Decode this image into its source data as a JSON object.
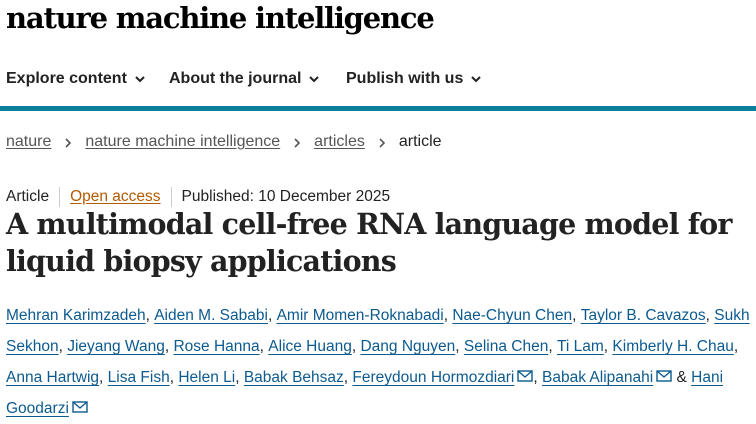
{
  "header": {
    "brand": "nature machine intelligence"
  },
  "nav": {
    "items": [
      {
        "label": "Explore content"
      },
      {
        "label": "About the journal"
      },
      {
        "label": "Publish with us"
      }
    ]
  },
  "breadcrumb": {
    "items": [
      {
        "label": "nature"
      },
      {
        "label": "nature machine intelligence"
      },
      {
        "label": "articles"
      },
      {
        "label": "article"
      }
    ]
  },
  "article": {
    "type": "Article",
    "access": "Open access",
    "published": "Published: 10 December 2025",
    "title": "A multimodal cell-free RNA language model for liquid biopsy applications",
    "authors": [
      {
        "name": "Mehran Karimzadeh",
        "sep": ", "
      },
      {
        "name": "Aiden M. Sababi",
        "sep": ", "
      },
      {
        "name": "Amir Momen-Roknabadi",
        "sep": ", "
      },
      {
        "name": "Nae-Chyun Chen",
        "sep": ", "
      },
      {
        "name": "Taylor B. Cavazos",
        "sep": ", "
      },
      {
        "name": "Sukh Sekhon",
        "sep": ", "
      },
      {
        "name": "Jieyang Wang",
        "sep": ", "
      },
      {
        "name": "Rose Hanna",
        "sep": ", "
      },
      {
        "name": "Alice Huang",
        "sep": ", "
      },
      {
        "name": "Dang Nguyen",
        "sep": ", "
      },
      {
        "name": "Selina Chen",
        "sep": ", "
      },
      {
        "name": "Ti Lam",
        "sep": ", "
      },
      {
        "name": "Kimberly H. Chau",
        "sep": ", "
      },
      {
        "name": "Anna Hartwig",
        "sep": ", "
      },
      {
        "name": "Lisa Fish",
        "sep": ", "
      },
      {
        "name": "Helen Li",
        "sep": ", "
      },
      {
        "name": "Babak Behsaz",
        "sep": ", "
      },
      {
        "name": "Fereydoun Hormozdiari",
        "sep": ", "
      },
      {
        "name": "Babak Alipanahi",
        "sep": " & "
      },
      {
        "name": "Hani Goodarzi",
        "sep": ""
      }
    ]
  },
  "icons": {
    "nav_dropdown": "chevron-down-icon",
    "breadcrumb_separator": "chevron-right-icon",
    "corresponding_author": "mail-icon"
  },
  "colors": {
    "accent_rule": "#0c7d9a",
    "author_link": "#0c5a8f",
    "open_access": "#b35900",
    "text": "#222222"
  }
}
